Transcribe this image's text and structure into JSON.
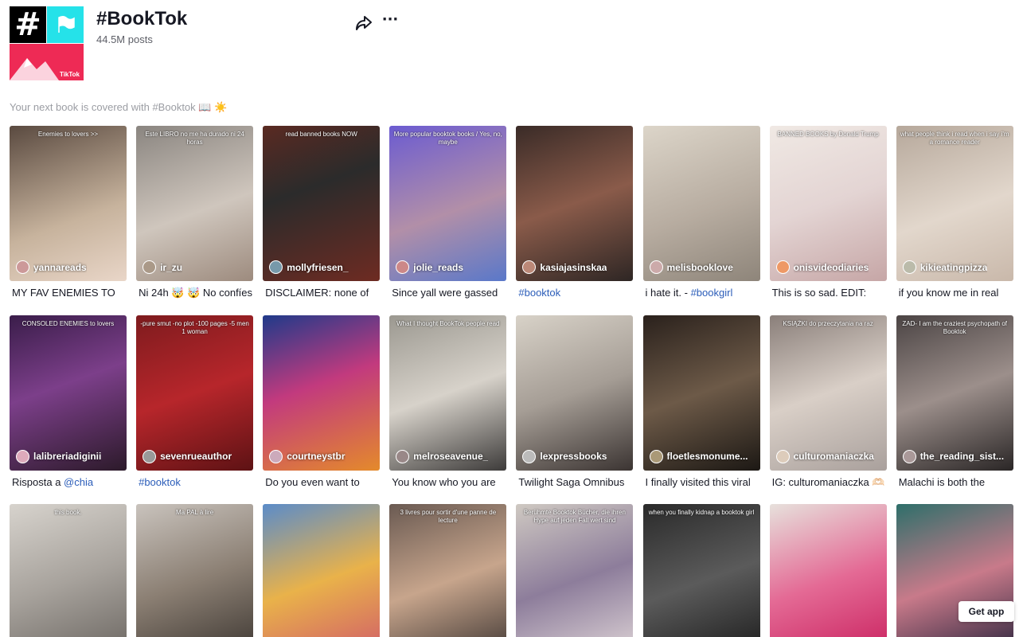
{
  "header": {
    "logo_glyph": "#",
    "logo_brand": "TikTok",
    "title": "#BookTok",
    "posts": "44.5M posts",
    "share_icon": "share-icon",
    "more_label": "···"
  },
  "description": "Your next book is covered with #Booktok 📖 ☀️",
  "colors": {
    "logo_black": "#000000",
    "logo_cyan": "#25e2e9",
    "logo_pink": "#ee2a55",
    "link_blue": "#2b5db9"
  },
  "videos": [
    {
      "user": "yannareads",
      "overlay": "Enemies to lovers >>",
      "caption": "MY FAV ENEMIES TO",
      "bg": "linear-gradient(160deg,#5a4a40,#c7b39d 60%,#e9d6c8)",
      "avatar": "#c99"
    },
    {
      "user": "ir_zu",
      "overlay": "Este LIBRO no me ha durado ni 24 horas",
      "caption": "Ni 24h 🤯 🤯 No confíes",
      "bg": "linear-gradient(160deg,#8a8580,#cfc6bd 55%,#9d8b7e)",
      "avatar": "#a98"
    },
    {
      "user": "mollyfriesen_",
      "overlay": "read banned books NOW",
      "caption": "DISCLAIMER: none of",
      "bg": "linear-gradient(160deg,#5a2a22,#2b2b2b 40%,#6e2b22)",
      "avatar": "#79a"
    },
    {
      "user": "jolie_reads",
      "overlay": "More popular booktok books / Yes, no, maybe",
      "caption": "Since yall were gassed",
      "bg": "linear-gradient(160deg,#6b5bd1,#b28fa8 55%,#5a78c9)",
      "avatar": "#c88"
    },
    {
      "user": "kasiajasinskaa",
      "overlay": "",
      "caption": "#booktok",
      "caption_link": true,
      "bg": "linear-gradient(160deg,#3a2b27,#8a5b4a 50%,#2e2624)",
      "avatar": "#b87"
    },
    {
      "user": "melisbooklove",
      "overlay": "",
      "caption": "i hate it. - #bookgirl",
      "caption_link_tail": "#bookgirl",
      "bg": "linear-gradient(160deg,#dcd5c9,#b7aca0 55%,#8e857a)",
      "avatar": "#caa"
    },
    {
      "user": "onisvideodiaries",
      "overlay": "BANNED BOOKS by Donald Trump",
      "caption": "This is so sad. EDIT:",
      "bg": "linear-gradient(160deg,#f0e9e4,#e3d4d3 50%,#c6a6a6)",
      "avatar": "#e96"
    },
    {
      "user": "kikieatingpizza",
      "overlay": "what people think i read when i say i'm a romance reader",
      "caption": "if you know me in real",
      "bg": "linear-gradient(160deg,#b6a89b,#e2d7cc 55%,#c9b8aa)",
      "avatar": "#bba"
    },
    {
      "user": "lalibreriadiginii",
      "overlay": "CONSOLED ENEMIES to lovers",
      "caption": "Risposta a @chia",
      "caption_link_tail": "@chia",
      "bg": "linear-gradient(160deg,#3a1d4a,#7c3f8a 45%,#2c1a2a)",
      "avatar": "#dab"
    },
    {
      "user": "sevenrueauthor",
      "overlay": "-pure smut -no plot -100 pages -5 men 1 woman",
      "caption": "#booktok",
      "caption_link": true,
      "bg": "linear-gradient(160deg,#7e1b1e,#b7262b 50%,#5d1214)",
      "avatar": "#999"
    },
    {
      "user": "courtneystbr",
      "overlay": "",
      "caption": "Do you even want to",
      "bg": "linear-gradient(160deg,#1f3a8a,#c23a7e 45%,#e48a2b)",
      "avatar": "#cab"
    },
    {
      "user": "melroseavenue_",
      "overlay": "What I thought BookTok people read",
      "caption": "You know who you are",
      "bg": "linear-gradient(160deg,#9b9890,#d7d2ca 50%,#3d3b3a)",
      "avatar": "#988"
    },
    {
      "user": "lexpressbooks",
      "overlay": "",
      "caption": "Twilight Saga Omnibus",
      "bg": "linear-gradient(160deg,#d8d2c8,#a59d95 50%,#3b3432)",
      "avatar": "#bbb"
    },
    {
      "user": "floetlesmonume...",
      "overlay": "",
      "caption": "I finally visited this viral",
      "bg": "linear-gradient(160deg,#2a211c,#6d5a48 50%,#1c1814)",
      "avatar": "#a97"
    },
    {
      "user": "culturomaniaczka",
      "overlay": "KSIĄŻKI do przeczytania na raz",
      "caption": "IG: culturomaniaczka 🫶🏻",
      "bg": "linear-gradient(160deg,#8a7f7a,#d9cfc7 50%,#a9a09c)",
      "avatar": "#dcb"
    },
    {
      "user": "the_reading_sist...",
      "overlay": "ZAD- I am the craziest psychopath of Booktok",
      "caption": "Malachi is both the",
      "bg": "linear-gradient(160deg,#4b4444,#9c8f8b 50%,#2a2626)",
      "avatar": "#a99"
    },
    {
      "user": "",
      "overlay": "this book.",
      "caption": "",
      "bg": "linear-gradient(160deg,#d7d3cd,#a7a29c 50%,#6a6560)",
      "avatar": ""
    },
    {
      "user": "",
      "overlay": "Ma PAL à lire",
      "caption": "",
      "bg": "linear-gradient(160deg,#c9c3bd,#8b7f73 50%,#3b3530)",
      "avatar": ""
    },
    {
      "user": "",
      "overlay": "",
      "caption": "",
      "bg": "linear-gradient(160deg,#5b8cc9,#e9b24a 50%,#d05a6a)",
      "avatar": ""
    },
    {
      "user": "",
      "overlay": "3 livres pour sortir d'une panne de lecture",
      "caption": "",
      "bg": "linear-gradient(160deg,#6a5a52,#c7a58c 50%,#3d3532)",
      "avatar": ""
    },
    {
      "user": "",
      "overlay": "Berühmte Booktok Bücher, die ihren Hype auf jeden Fall wert sind",
      "caption": "",
      "bg": "linear-gradient(160deg,#cfc9c2,#8d7d9b 50%,#e0d6d8)",
      "avatar": ""
    },
    {
      "user": "",
      "overlay": "when you finally kidnap a booktok girl",
      "caption": "",
      "bg": "linear-gradient(160deg,#2a2a2a,#5b5b5b 50%,#1a1a1a)",
      "avatar": ""
    },
    {
      "user": "",
      "overlay": "",
      "caption": "",
      "bg": "linear-gradient(160deg,#e7e1dc,#e46a95 50%,#c81f5d)",
      "avatar": ""
    },
    {
      "user": "",
      "overlay": "",
      "caption": "",
      "bg": "linear-gradient(160deg,#2e6f6a,#c87a8a 50%,#24213a)",
      "avatar": ""
    }
  ],
  "get_app": "Get app"
}
